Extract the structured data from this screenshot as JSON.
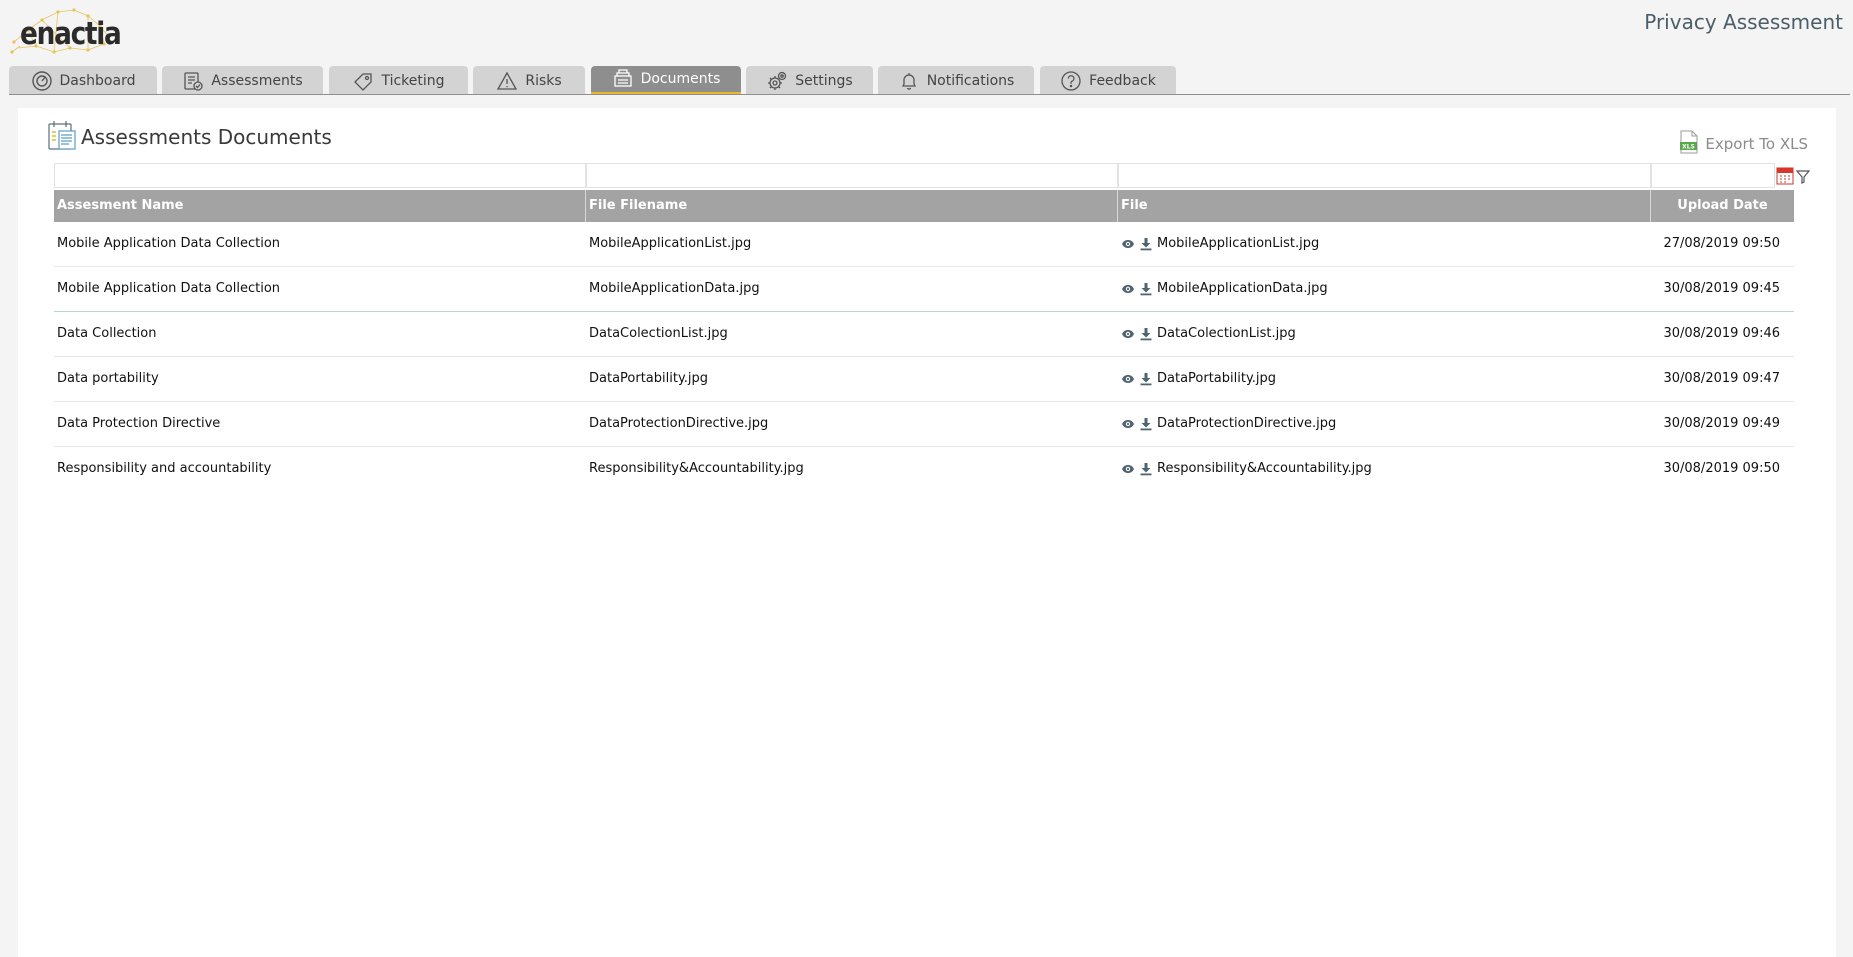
{
  "header": {
    "logo_text": "enactia",
    "app_title": "Privacy Assessment"
  },
  "tabs": [
    {
      "label": "Dashboard",
      "icon": "gauge-icon",
      "active": false
    },
    {
      "label": "Assessments",
      "icon": "clipboard-check-icon",
      "active": false
    },
    {
      "label": "Ticketing",
      "icon": "ticket-icon",
      "active": false
    },
    {
      "label": "Risks",
      "icon": "warning-icon",
      "active": false
    },
    {
      "label": "Documents",
      "icon": "documents-icon",
      "active": true
    },
    {
      "label": "Settings",
      "icon": "gears-icon",
      "active": false
    },
    {
      "label": "Notifications",
      "icon": "bell-icon",
      "active": false
    },
    {
      "label": "Feedback",
      "icon": "question-icon",
      "active": false
    }
  ],
  "page": {
    "title": "Assessments Documents",
    "export_label": "Export To XLS",
    "xls_icon_label": "XLS"
  },
  "table": {
    "columns": [
      "Assesment Name",
      "File Filename",
      "File",
      "Upload Date"
    ],
    "rows": [
      {
        "name": "Mobile Application Data Collection",
        "filename": "MobileApplicationList.jpg",
        "file": "MobileApplicationList.jpg",
        "date": "27/08/2019 09:50"
      },
      {
        "name": "Mobile Application Data Collection",
        "filename": "MobileApplicationData.jpg",
        "file": "MobileApplicationData.jpg",
        "date": "30/08/2019 09:45"
      },
      {
        "name": "Data Collection",
        "filename": "DataColectionList.jpg",
        "file": "DataColectionList.jpg",
        "date": "30/08/2019 09:46"
      },
      {
        "name": "Data portability",
        "filename": "DataPortability.jpg",
        "file": "DataPortability.jpg",
        "date": "30/08/2019 09:47"
      },
      {
        "name": "Data Protection Directive",
        "filename": "DataProtectionDirective.jpg",
        "file": "DataProtectionDirective.jpg",
        "date": "30/08/2019 09:49"
      },
      {
        "name": "Responsibility and accountability",
        "filename": "Responsibility&Accountability.jpg",
        "file": "Responsibility&Accountability.jpg",
        "date": "30/08/2019 09:50"
      }
    ]
  },
  "colors": {
    "accent": "#e8b830",
    "header_gray": "#a3a3a3",
    "active_tab": "#8e8e8e",
    "title_blue_gray": "#4a5f6a"
  }
}
